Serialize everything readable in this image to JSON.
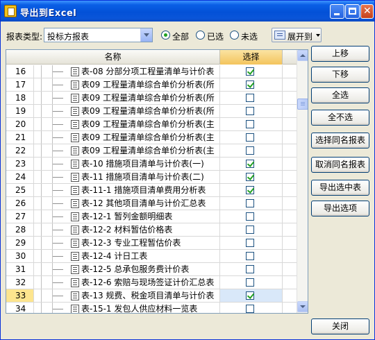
{
  "window": {
    "title": "导出到Excel"
  },
  "filter": {
    "label": "报表类型:",
    "value": "投标方报表"
  },
  "radios": [
    {
      "label": "全部",
      "checked": true
    },
    {
      "label": "已选",
      "checked": false
    },
    {
      "label": "未选",
      "checked": false
    }
  ],
  "expand": {
    "label": "展开到"
  },
  "grid": {
    "headers": {
      "name": "名称",
      "select": "选择"
    },
    "rows": [
      {
        "num": "16",
        "name": "表-08 分部分项工程量清单与计价表",
        "checked": true
      },
      {
        "num": "17",
        "name": "表09 工程量清单综合单价分析表(所",
        "checked": true
      },
      {
        "num": "18",
        "name": "表09 工程量清单综合单价分析表(所",
        "checked": false
      },
      {
        "num": "19",
        "name": "表09 工程量清单综合单价分析表(所",
        "checked": false
      },
      {
        "num": "20",
        "name": "表09 工程量清单综合单价分析表(主",
        "checked": false
      },
      {
        "num": "21",
        "name": "表09 工程量清单综合单价分析表(主",
        "checked": false
      },
      {
        "num": "22",
        "name": "表09 工程量清单综合单价分析表(主",
        "checked": false
      },
      {
        "num": "23",
        "name": "表-10 措施项目清单与计价表(一)",
        "checked": true
      },
      {
        "num": "24",
        "name": "表-11 措施项目清单与计价表(二)",
        "checked": true
      },
      {
        "num": "25",
        "name": "表-11-1 措施项目清单费用分析表",
        "checked": true
      },
      {
        "num": "26",
        "name": "表-12 其他项目清单与计价汇总表",
        "checked": false
      },
      {
        "num": "27",
        "name": "表-12-1 暂列金额明细表",
        "checked": false
      },
      {
        "num": "28",
        "name": "表-12-2 材料暂估价格表",
        "checked": false
      },
      {
        "num": "29",
        "name": "表-12-3 专业工程暂估价表",
        "checked": false
      },
      {
        "num": "30",
        "name": "表-12-4 计日工表",
        "checked": false
      },
      {
        "num": "31",
        "name": "表-12-5 总承包服务费计价表",
        "checked": false
      },
      {
        "num": "32",
        "name": "表-12-6 索赔与现场签证计价汇总表",
        "checked": false
      },
      {
        "num": "33",
        "name": "表-13 规费、税金项目清单与计价表",
        "checked": true,
        "selected": true
      },
      {
        "num": "34",
        "name": "表-15-1 发包人供应材料一览表",
        "checked": false
      }
    ]
  },
  "buttons": {
    "move_up": "上移",
    "move_down": "下移",
    "select_all": "全选",
    "select_none": "全不选",
    "select_same": "选择同名报表",
    "cancel_same": "取消同名报表",
    "export_selected": "导出选中表",
    "export_options": "导出选项",
    "close": "关闭"
  },
  "colors": {
    "title_bar": "#0a5fe6",
    "check_mark": "#21a121",
    "selected_row_number": "#fde58e",
    "header_highlight": "#f3c45c"
  }
}
